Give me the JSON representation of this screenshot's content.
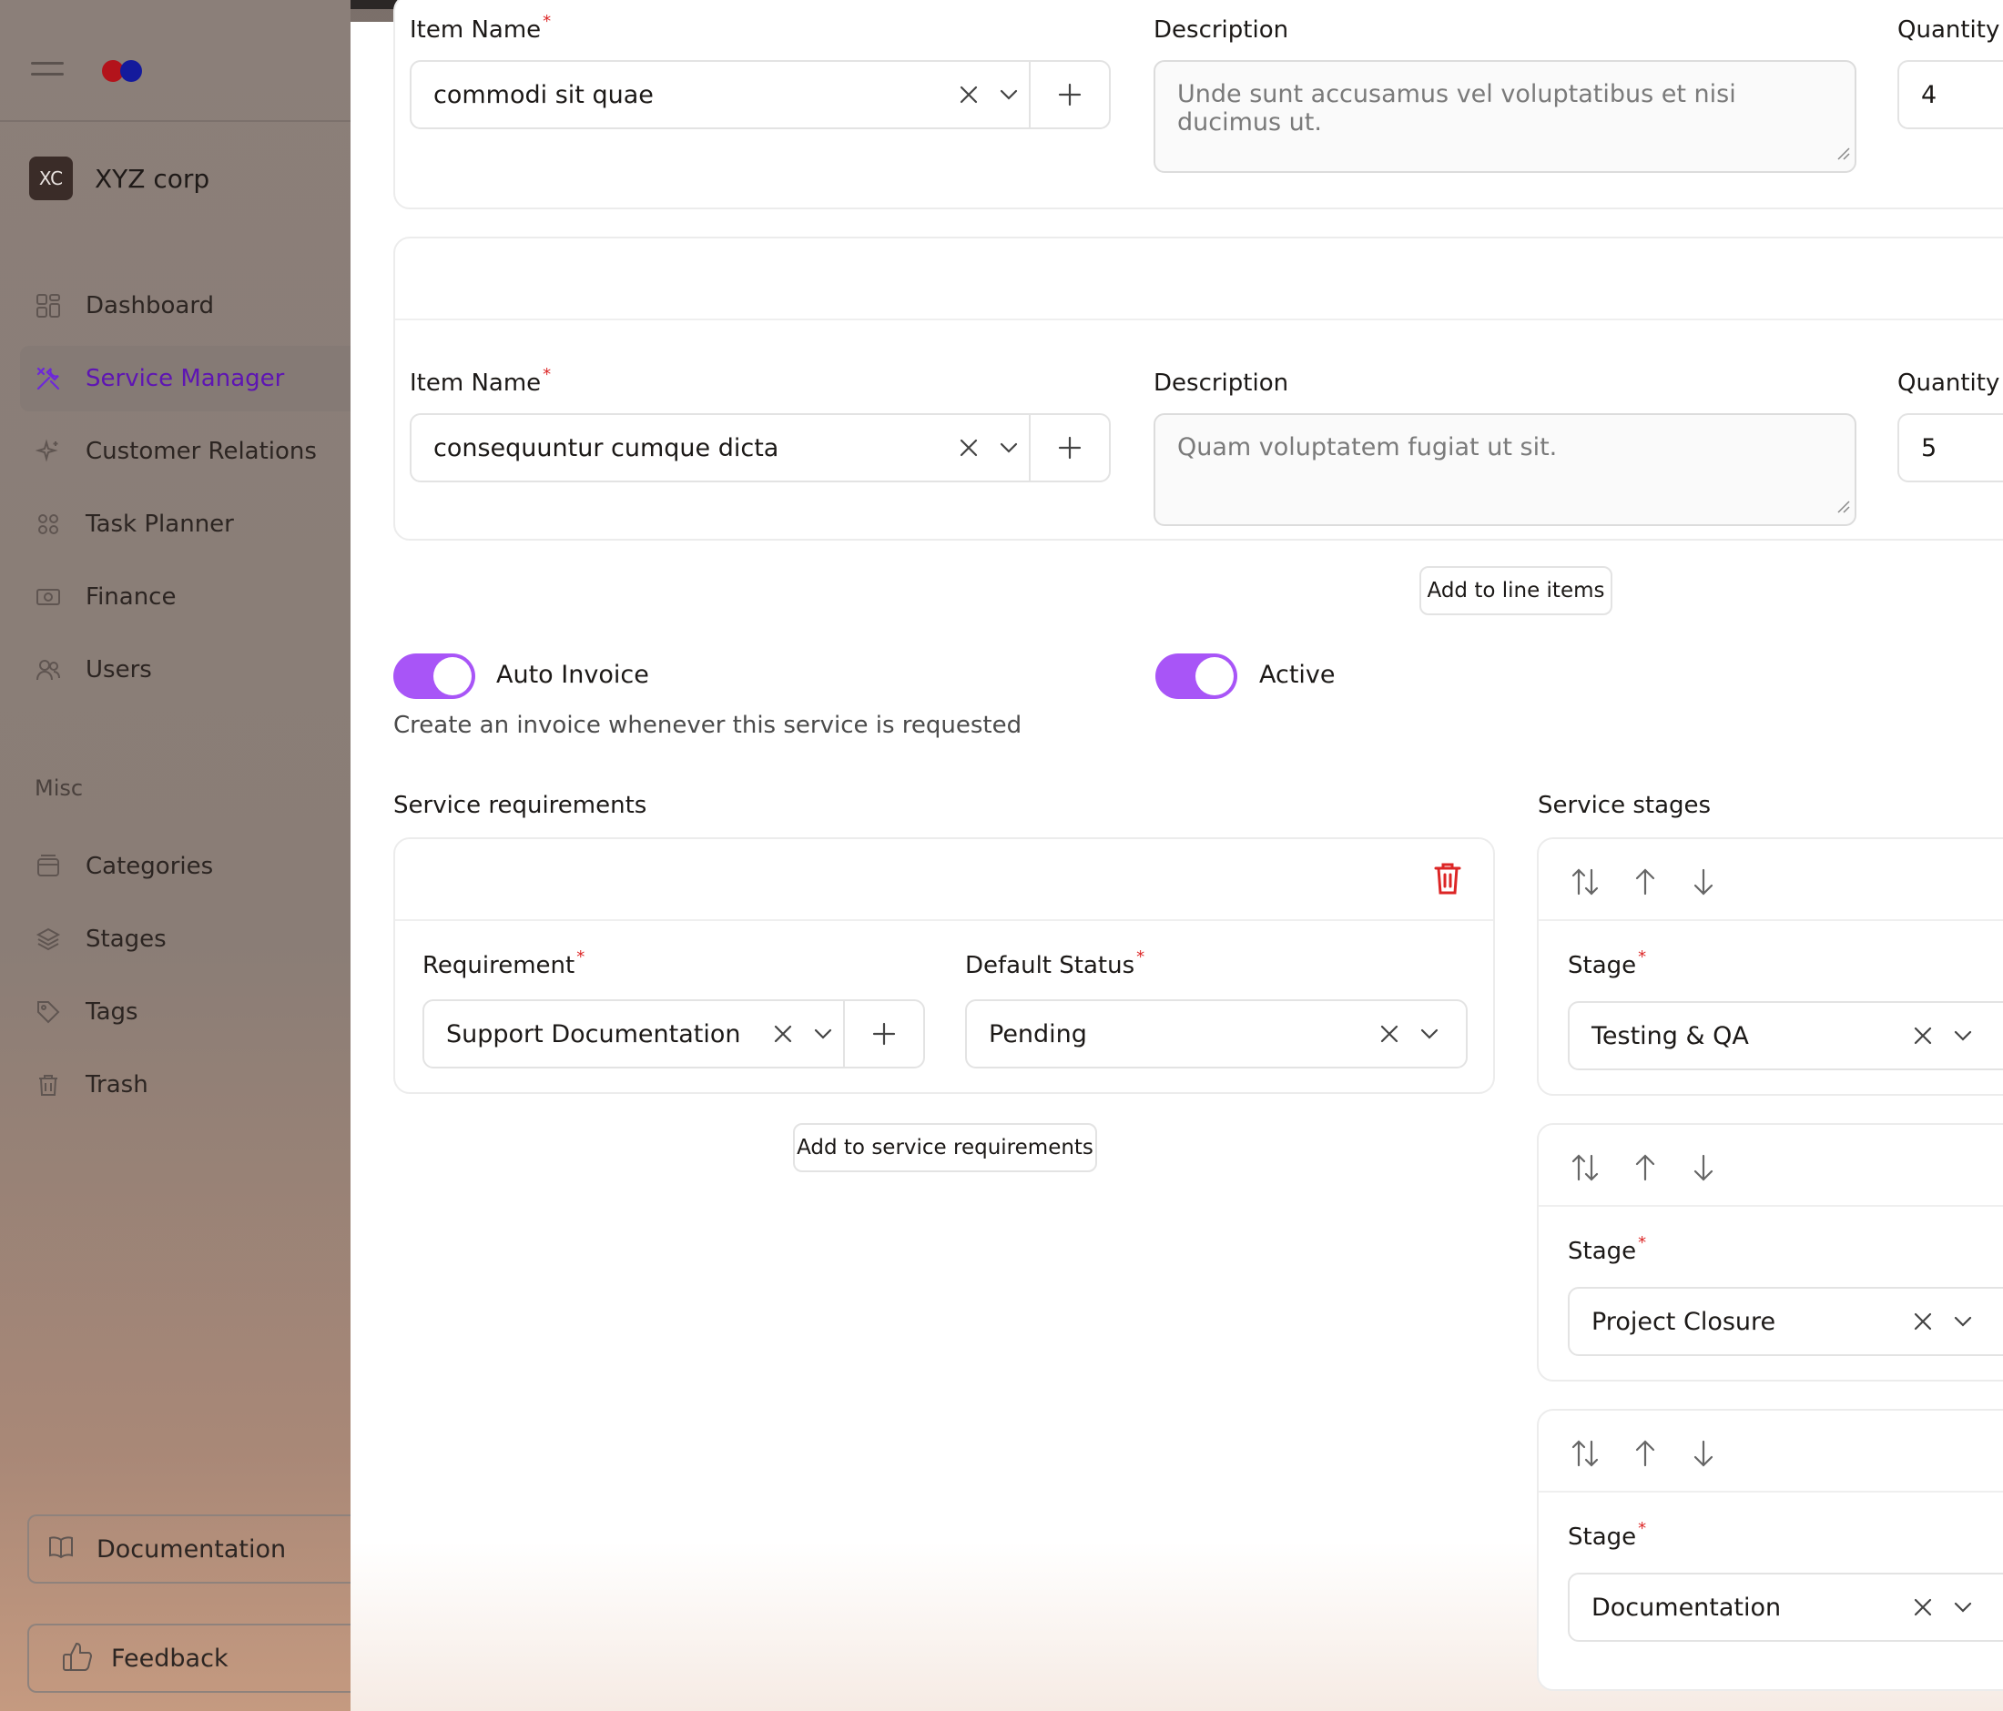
{
  "sidebar": {
    "org": {
      "initials": "XC",
      "name": "XYZ corp"
    },
    "nav": [
      {
        "label": "Dashboard",
        "icon": "grid-icon"
      },
      {
        "label": "Service Manager",
        "icon": "tools-icon",
        "active": true
      },
      {
        "label": "Customer Relations",
        "icon": "sparkle-icon"
      },
      {
        "label": "Task Planner",
        "icon": "grid-small-icon"
      },
      {
        "label": "Finance",
        "icon": "cash-icon"
      },
      {
        "label": "Users",
        "icon": "users-icon"
      }
    ],
    "misc_label": "Misc",
    "misc": [
      {
        "label": "Categories",
        "icon": "archive-icon"
      },
      {
        "label": "Stages",
        "icon": "layers-icon"
      },
      {
        "label": "Tags",
        "icon": "tag-icon"
      },
      {
        "label": "Trash",
        "icon": "trash-icon"
      }
    ],
    "documentation": "Documentation",
    "feedback": "Feedback"
  },
  "line_items": [
    {
      "item_label": "Item Name",
      "item_value": "commodi sit quae",
      "desc_label": "Description",
      "desc_value": "Unde sunt accusamus vel voluptatibus et nisi ducimus ut.",
      "qty_label": "Quantity",
      "qty_value": "4"
    },
    {
      "item_label": "Item Name",
      "item_value": "consequuntur cumque dicta",
      "desc_label": "Description",
      "desc_value": "Quam voluptatem fugiat ut sit.",
      "qty_label": "Quantity",
      "qty_value": "5"
    }
  ],
  "add_line_items": "Add to line items",
  "auto_invoice": {
    "label": "Auto Invoice",
    "hint": "Create an invoice whenever this service is requested",
    "on": true
  },
  "active": {
    "label": "Active",
    "on": true
  },
  "requirements": {
    "title": "Service requirements",
    "req_label": "Requirement",
    "req_value": "Support Documentation",
    "status_label": "Default Status",
    "status_value": "Pending",
    "add_button": "Add to service requirements"
  },
  "stages": {
    "title": "Service stages",
    "stage_label": "Stage",
    "items": [
      "Testing & QA",
      "Project Closure",
      "Documentation"
    ]
  },
  "colors": {
    "accent": "#a855f7",
    "active_nav": "#5e15b3",
    "danger": "#dc2626"
  }
}
